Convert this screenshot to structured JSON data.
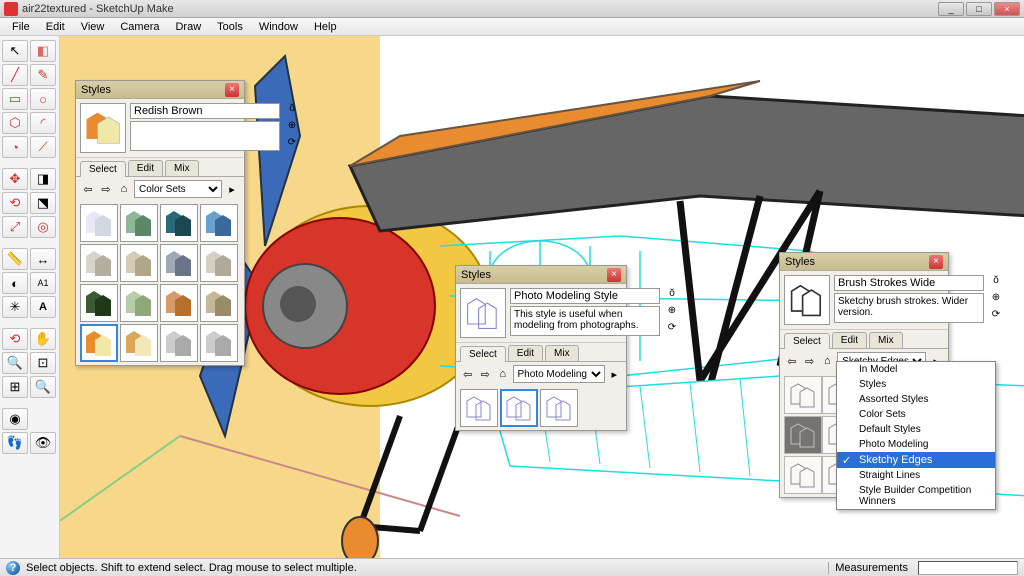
{
  "window": {
    "title": "air22textured - SketchUp Make",
    "min": "_",
    "max": "□",
    "close": "×"
  },
  "menu": [
    "File",
    "Edit",
    "View",
    "Camera",
    "Draw",
    "Tools",
    "Window",
    "Help"
  ],
  "status": {
    "hint": "Select objects. Shift to extend select. Drag mouse to select multiple.",
    "measurements_label": "Measurements"
  },
  "panel1": {
    "title": "Styles",
    "style_name": "Redish Brown",
    "desc": "",
    "tabs": [
      "Select",
      "Edit",
      "Mix"
    ],
    "dropdown": "Color Sets",
    "accent_main": "#e98b2f",
    "accent_side": "#f0e8a8"
  },
  "panel2": {
    "title": "Styles",
    "style_name": "Photo Modeling Style",
    "desc": "This style is useful when modeling from photographs.",
    "tabs": [
      "Select",
      "Edit",
      "Mix"
    ],
    "dropdown": "Photo Modeling"
  },
  "panel3": {
    "title": "Styles",
    "style_name": "Brush Strokes Wide",
    "desc": "Sketchy brush strokes. Wider version.",
    "tabs": [
      "Select",
      "Edit",
      "Mix"
    ],
    "dropdown": "Sketchy Edges",
    "menu_items": [
      "In Model",
      "Styles",
      "Assorted Styles",
      "Color Sets",
      "Default Styles",
      "Photo Modeling",
      "Sketchy Edges",
      "Straight Lines",
      "Style Builder Competition Winners"
    ]
  },
  "swatch_colors": [
    [
      "#e8e8f4",
      "#d0d8e0"
    ],
    [
      "#8fb89a",
      "#5a8868"
    ],
    [
      "#2a6a78",
      "#184850"
    ],
    [
      "#6aa0cc",
      "#3a6a9c"
    ],
    [
      "#d8d4cc",
      "#b4aea0"
    ],
    [
      "#d4ccb8",
      "#b0a688"
    ],
    [
      "#a0a8b4",
      "#6a7488"
    ],
    [
      "#d4d0c4",
      "#b0a898"
    ],
    [
      "#3a5a34",
      "#203818"
    ],
    [
      "#b8ccaa",
      "#8fa878"
    ],
    [
      "#d89a6a",
      "#b4702c"
    ],
    [
      "#c4b898",
      "#9a8c68"
    ],
    [
      "#e98b2f",
      "#f0e8a8"
    ],
    [
      "#d8a858",
      "#f0e8b8"
    ],
    [
      "#cccccc",
      "#aaaaaa"
    ],
    [
      "#cccccc",
      "#aaaaaa"
    ]
  ]
}
